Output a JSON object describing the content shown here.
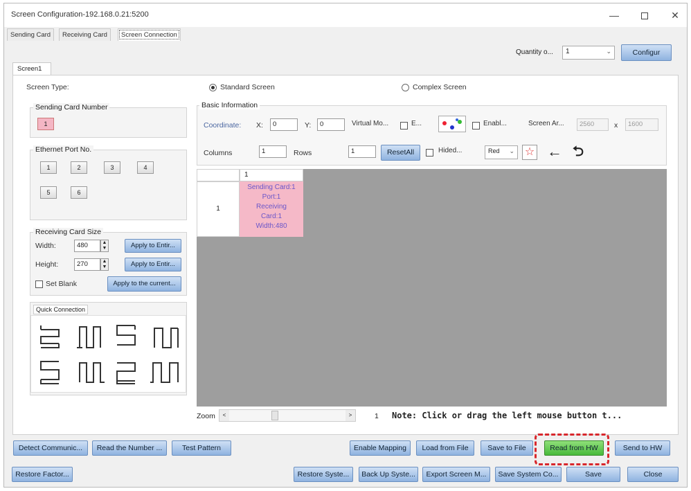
{
  "window": {
    "title": "Screen Configuration-192.168.0.21:5200",
    "min": "—",
    "close": "✕"
  },
  "tabs": [
    "Sending Card",
    "Receiving Card",
    "Screen Connection"
  ],
  "quantity": {
    "label": "Quantity o...",
    "value": "1"
  },
  "buttons": {
    "configure": "Configur",
    "reset_all": "ResetAll",
    "apply_width": "Apply to Entir...",
    "apply_height": "Apply to Entir...",
    "apply_current": "Apply to the current..."
  },
  "screen_tab": "Screen1",
  "screen_type": {
    "label": "Screen Type:",
    "standard": "Standard Screen",
    "complex": "Complex Screen"
  },
  "sending_card": {
    "title": "Sending Card Number",
    "value": "1"
  },
  "ethernet": {
    "title": "Ethernet Port No.",
    "ports": [
      "1",
      "2",
      "3",
      "4",
      "5",
      "6"
    ]
  },
  "receiving_size": {
    "title": "Receiving Card Size",
    "width_label": "Width:",
    "width": "480",
    "height_label": "Height:",
    "height": "270",
    "set_blank": "Set Blank"
  },
  "quick_connection": "Quick Connection",
  "basic_info": {
    "title": "Basic Information",
    "coordinate": "Coordinate:",
    "x_label": "X:",
    "x": "0",
    "y_label": "Y:",
    "y": "0",
    "virtual": "Virtual Mo...",
    "e_label": "E...",
    "enable": "Enabl...",
    "screen_area": "Screen Ar...",
    "area_w": "2560",
    "times": "x",
    "area_h": "1600",
    "columns_label": "Columns",
    "columns": "1",
    "rows_label": "Rows",
    "rows": "1",
    "hided": "Hided...",
    "color": "Red",
    "star": "☆",
    "back_arrow": "←",
    "undo": "⮌"
  },
  "grid": {
    "col_header": "1",
    "row_header": "1",
    "cell_lines": [
      "Sending Card:1",
      "Port:1",
      "Receiving",
      "Card:1",
      "Width:480"
    ]
  },
  "zoom": {
    "label": "Zoom",
    "left": "<",
    "right": ">",
    "value": "1"
  },
  "note": "Note: Click or drag the left mouse button t...",
  "bottom_row1": [
    "Detect Communic...",
    "Read the Number ...",
    "Test Pattern",
    "Enable Mapping",
    "Load from File",
    "Save to File",
    "Read from HW",
    "Send to HW"
  ],
  "bottom_row2": [
    "Restore Factor...",
    "Restore Syste...",
    "Back Up Syste...",
    "Export Screen M...",
    "Save System Co...",
    "Save",
    "Close"
  ],
  "colors": {
    "highlight": "#d8272c",
    "read_hw": "#48b93a",
    "cell_pink": "#f5b9c8"
  }
}
